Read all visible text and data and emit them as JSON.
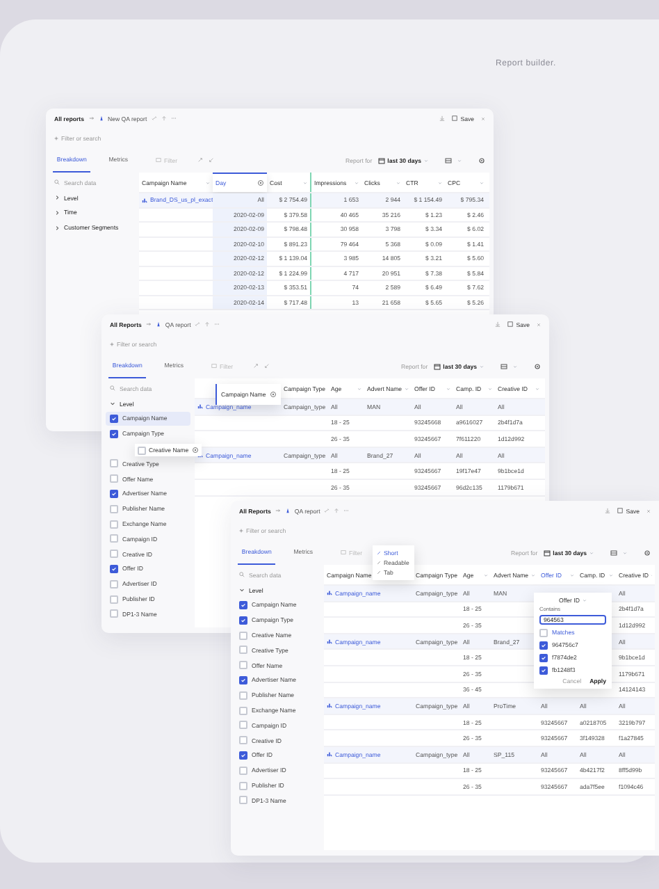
{
  "page_title": "Report builder.",
  "windows": [
    {
      "header": {
        "root": "All reports",
        "report": "New QA report",
        "save": "Save"
      },
      "search_placeholder": "Filter or search",
      "tabs": [
        {
          "label": "Breakdown",
          "selected": true
        },
        {
          "label": "Metrics",
          "selected": false
        }
      ],
      "toolbar": {
        "filter": "Filter",
        "report_for": "Report for",
        "period": "last 30 days"
      },
      "sidebar": {
        "search_placeholder": "Search data",
        "items": [
          {
            "label": "Level",
            "kind": "group",
            "expanded": false
          },
          {
            "label": "Time",
            "kind": "group",
            "expanded": false
          },
          {
            "label": "Customer Segments",
            "kind": "group",
            "expanded": false
          }
        ]
      },
      "table": {
        "columns": [
          {
            "label": "Campaign Name",
            "dragging": false,
            "drop_target": false
          },
          {
            "label": "Day",
            "dragging": true,
            "drop_target": false
          },
          {
            "label": "Cost",
            "dragging": false,
            "drop_target": false
          },
          {
            "label": "Impressions",
            "dragging": false,
            "drop_target": true
          },
          {
            "label": "Clicks",
            "dragging": false,
            "drop_target": false
          },
          {
            "label": "CTR",
            "dragging": false,
            "drop_target": false
          },
          {
            "label": "CPC",
            "dragging": false,
            "drop_target": false
          }
        ],
        "rows": [
          {
            "kind": "group",
            "cells": [
              "Brand_DS_us_pl_exact",
              "All",
              "$ 2 754.49",
              "1 653",
              "2 944",
              "$ 1 154.49",
              "$ 795.34"
            ]
          },
          {
            "kind": "detail",
            "cells": [
              null,
              "2020-02-09",
              "$ 379.58",
              "40 465",
              "35 216",
              "$ 1.23",
              "$ 2.46"
            ]
          },
          {
            "kind": "detail",
            "cells": [
              null,
              "2020-02-09",
              "$ 798.48",
              "30 958",
              "3 798",
              "$ 3.34",
              "$ 6.02"
            ]
          },
          {
            "kind": "detail",
            "cells": [
              null,
              "2020-02-10",
              "$ 891.23",
              "79 464",
              "5 368",
              "$ 0.09",
              "$ 1.41"
            ]
          },
          {
            "kind": "detail",
            "cells": [
              null,
              "2020-02-12",
              "$ 1 139.04",
              "3 985",
              "14 805",
              "$ 3.21",
              "$ 5.60"
            ]
          },
          {
            "kind": "detail",
            "cells": [
              null,
              "2020-02-12",
              "$ 1 224.99",
              "4 717",
              "20 951",
              "$ 7.38",
              "$ 5.84"
            ]
          },
          {
            "kind": "detail",
            "cells": [
              null,
              "2020-02-13",
              "$ 353.51",
              "74",
              "2 589",
              "$ 6.49",
              "$ 7.62"
            ]
          },
          {
            "kind": "detail",
            "cells": [
              null,
              "2020-02-14",
              "$ 717.48",
              "13",
              "21 658",
              "$ 5.65",
              "$ 5.26"
            ]
          }
        ]
      }
    },
    {
      "header": {
        "root": "All Reports",
        "report": "QA report",
        "save": "Save"
      },
      "search_placeholder": "Filter or search",
      "tabs": [
        {
          "label": "Breakdown",
          "selected": true
        },
        {
          "label": "Metrics",
          "selected": false
        }
      ],
      "toolbar": {
        "filter": "Filter",
        "report_for": "Report for",
        "period": "last 30 days"
      },
      "sidebar": {
        "search_placeholder": "Search data",
        "items": [
          {
            "label": "Level",
            "kind": "group",
            "expanded": true
          },
          {
            "label": "Campaign Name",
            "kind": "field",
            "checked": true,
            "selected": true
          },
          {
            "label": "Campaign Type",
            "kind": "field",
            "checked": true,
            "selected": false
          },
          {
            "kind": "slot"
          },
          {
            "label": "Creative Type",
            "kind": "field",
            "checked": false,
            "selected": false
          },
          {
            "label": "Offer Name",
            "kind": "field",
            "checked": false,
            "selected": false
          },
          {
            "label": "Advertiser Name",
            "kind": "field",
            "checked": true,
            "selected": false
          },
          {
            "label": "Publisher Name",
            "kind": "field",
            "checked": false,
            "selected": false
          },
          {
            "label": "Exchange Name",
            "kind": "field",
            "checked": false,
            "selected": false
          },
          {
            "label": "Campaign ID",
            "kind": "field",
            "checked": false,
            "selected": false
          },
          {
            "label": "Creative ID",
            "kind": "field",
            "checked": false,
            "selected": false
          },
          {
            "label": "Offer ID",
            "kind": "field",
            "checked": true,
            "selected": false
          },
          {
            "label": "Advertiser ID",
            "kind": "field",
            "checked": false,
            "selected": false
          },
          {
            "label": "Publisher ID",
            "kind": "field",
            "checked": false,
            "selected": false
          },
          {
            "label": "DP1-3 Name",
            "kind": "field",
            "checked": false,
            "selected": false
          }
        ]
      },
      "drag_ghosts": [
        {
          "label": "Campaign Name",
          "kind": "column"
        },
        {
          "label": "Creative Name",
          "kind": "field",
          "checked": false
        }
      ],
      "table": {
        "columns": [
          {},
          {
            "label": "Campaign Type"
          },
          {
            "label": "Age"
          },
          {
            "label": "Advert Name"
          },
          {
            "label": "Offer ID"
          },
          {
            "label": "Camp. ID"
          },
          {
            "label": "Creative ID"
          }
        ],
        "rows": [
          {
            "kind": "group",
            "cells": [
              "Campaign_name",
              "Campaign_type",
              "All",
              "MAN",
              "All",
              "All",
              "All"
            ]
          },
          {
            "kind": "detail",
            "cells": [
              null,
              null,
              "18 - 25",
              null,
              "93245668",
              "a9616027",
              "2b4f1d7a"
            ]
          },
          {
            "kind": "detail",
            "cells": [
              null,
              null,
              "26 - 35",
              null,
              "93245667",
              "7f611220",
              "1d12d992"
            ]
          },
          {
            "kind": "group",
            "cells": [
              "Campaign_name",
              "Campaign_type",
              "All",
              "Brand_27",
              "All",
              "All",
              "All"
            ]
          },
          {
            "kind": "detail",
            "cells": [
              null,
              null,
              "18 - 25",
              null,
              "93245667",
              "19f17e47",
              "9b1bce1d"
            ]
          },
          {
            "kind": "detail",
            "cells": [
              null,
              null,
              "26 - 35",
              null,
              "93245667",
              "96d2c135",
              "1179b671"
            ]
          }
        ]
      }
    },
    {
      "header": {
        "root": "All Reports",
        "report": "QA report",
        "save": "Save"
      },
      "search_placeholder": "Filter or search",
      "tabs": [
        {
          "label": "Breakdown",
          "selected": true
        },
        {
          "label": "Metrics",
          "selected": false
        }
      ],
      "toolbar": {
        "filter": "Filter",
        "report_for": "Report for",
        "period": "last 30 days"
      },
      "sidebar": {
        "search_placeholder": "Search data",
        "items": [
          {
            "label": "Level",
            "kind": "group",
            "expanded": true
          },
          {
            "label": "Campaign Name",
            "kind": "field",
            "checked": true,
            "selected": false
          },
          {
            "label": "Campaign Type",
            "kind": "field",
            "checked": true,
            "selected": false
          },
          {
            "label": "Creative Name",
            "kind": "field",
            "checked": false,
            "selected": false
          },
          {
            "label": "Creative Type",
            "kind": "field",
            "checked": false,
            "selected": false
          },
          {
            "label": "Offer Name",
            "kind": "field",
            "checked": false,
            "selected": false
          },
          {
            "label": "Advertiser Name",
            "kind": "field",
            "checked": true,
            "selected": false
          },
          {
            "label": "Publisher Name",
            "kind": "field",
            "checked": false,
            "selected": false
          },
          {
            "label": "Exchange Name",
            "kind": "field",
            "checked": false,
            "selected": false
          },
          {
            "label": "Campaign ID",
            "kind": "field",
            "checked": false,
            "selected": false
          },
          {
            "label": "Creative ID",
            "kind": "field",
            "checked": false,
            "selected": false
          },
          {
            "label": "Offer ID",
            "kind": "field",
            "checked": true,
            "selected": false
          },
          {
            "label": "Advertiser ID",
            "kind": "field",
            "checked": false,
            "selected": false
          },
          {
            "label": "Publisher ID",
            "kind": "field",
            "checked": false,
            "selected": false
          },
          {
            "label": "DP1-3 Name",
            "kind": "field",
            "checked": false,
            "selected": false
          }
        ]
      },
      "menu": {
        "items": [
          {
            "label": "Short",
            "selected": true
          },
          {
            "label": "Readable",
            "selected": false
          },
          {
            "label": "Tab",
            "selected": false
          }
        ]
      },
      "filter_popup": {
        "title": "Offer ID",
        "condition": "Contains",
        "value": "964563",
        "options": [
          {
            "label": "Matches",
            "checked": false
          },
          {
            "label": "964756c7",
            "checked": true
          },
          {
            "label": "f7874de2",
            "checked": true
          },
          {
            "label": "fb1248f3",
            "checked": true
          }
        ],
        "cancel": "Cancel",
        "apply": "Apply"
      },
      "table": {
        "columns": [
          {
            "label": "Campaign Name",
            "active": false
          },
          {
            "label": "Campaign Type",
            "active": false
          },
          {
            "label": "Age",
            "active": false
          },
          {
            "label": "Advert Name",
            "active": false
          },
          {
            "label": "Offer ID",
            "active": true
          },
          {
            "label": "Camp. ID",
            "active": false
          },
          {
            "label": "Creative ID",
            "active": false
          }
        ],
        "rows": [
          {
            "kind": "group",
            "cells": [
              "Campaign_name",
              "Campaign_type",
              "All",
              "MAN",
              null,
              null,
              "All"
            ]
          },
          {
            "kind": "detail",
            "cells": [
              null,
              null,
              "18 - 25",
              null,
              null,
              null,
              "2b4f1d7a"
            ]
          },
          {
            "kind": "detail",
            "cells": [
              null,
              null,
              "26 - 35",
              null,
              null,
              null,
              "1d12d992"
            ]
          },
          {
            "kind": "group",
            "cells": [
              "Campaign_name",
              "Campaign_type",
              "All",
              "Brand_27",
              null,
              null,
              "All"
            ]
          },
          {
            "kind": "detail",
            "cells": [
              null,
              null,
              "18 - 25",
              null,
              null,
              null,
              "9b1bce1d"
            ]
          },
          {
            "kind": "detail",
            "cells": [
              null,
              null,
              "26 - 35",
              null,
              null,
              null,
              "1179b671"
            ]
          },
          {
            "kind": "detail",
            "cells": [
              null,
              null,
              "36 - 45",
              null,
              null,
              null,
              "14124143"
            ]
          },
          {
            "kind": "group",
            "cells": [
              "Campaign_name",
              "Campaign_type",
              "All",
              "ProTime",
              "All",
              "All",
              "All"
            ]
          },
          {
            "kind": "detail",
            "cells": [
              null,
              null,
              "18 - 25",
              null,
              "93245667",
              "a0218705",
              "3219b797"
            ]
          },
          {
            "kind": "detail",
            "cells": [
              null,
              null,
              "26 - 35",
              null,
              "93245667",
              "3f149328",
              "f1a27845"
            ]
          },
          {
            "kind": "group",
            "cells": [
              "Campaign_name",
              "Campaign_type",
              "All",
              "SP_115",
              "All",
              "All",
              "All"
            ]
          },
          {
            "kind": "detail",
            "cells": [
              null,
              null,
              "18 - 25",
              null,
              "93245667",
              "4b4217f2",
              "8ff5d99b"
            ]
          },
          {
            "kind": "detail",
            "cells": [
              null,
              null,
              "26 - 35",
              null,
              "93245667",
              "ada7f5ee",
              "f1094c46"
            ]
          }
        ]
      }
    }
  ]
}
